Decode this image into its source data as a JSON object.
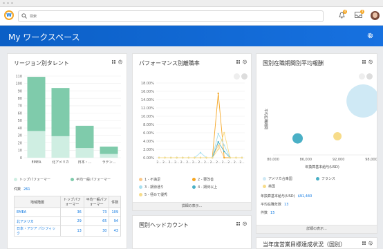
{
  "search": {
    "placeholder": "検索"
  },
  "header": {
    "notifications_count": "4",
    "inbox_count": "3"
  },
  "banner": {
    "title": "My ワークスペース"
  },
  "talent": {
    "title": "リージョン別タレント",
    "legend": [
      "トップパフォーマー",
      "平均一般パフォーマー"
    ],
    "count_label": "件数",
    "count_value": "261",
    "table_headers": [
      "地域階層",
      "トップパフォーマー",
      "平均一般パフォーマー",
      "件数"
    ],
    "table_rows": [
      {
        "region": "EMEA",
        "top": "36",
        "avg": "73",
        "count": "109"
      },
      {
        "region": "北アメリカ",
        "top": "29",
        "avg": "65",
        "count": "94"
      },
      {
        "region": "日本・アジア パシフィック",
        "top": "13",
        "avg": "30",
        "count": "43"
      }
    ]
  },
  "perf": {
    "title": "パフォーマンス別離職率",
    "legend": [
      "1 - 不満足",
      "2 - 要改善",
      "3 - 期待通り",
      "4 - 期待以上",
      "5 - 極めて優秀"
    ],
    "footer": "詳細の表示..."
  },
  "salary": {
    "title": "国別在職期間別平均報酬",
    "legend": [
      "アメリカ合衆国",
      "フランス",
      "英国"
    ],
    "kv": [
      {
        "label": "年換算基本給与(USD)",
        "value": "$91,440"
      },
      {
        "label": "平均在職年数",
        "value": "13"
      },
      {
        "label": "件数",
        "value": "15"
      }
    ],
    "footer": "詳細の表示..."
  },
  "headcount": {
    "title": "国別ヘッドカウント"
  },
  "sales": {
    "title": "当年度営業目標達成状況（国別）"
  },
  "colors": {
    "accent": "#0875e1",
    "top_performer": "#cfeee2",
    "avg_performer": "#7fcbab",
    "orange": "#f5a623",
    "teal": "#4ab0c6",
    "cyan": "#a9e0ef",
    "yellow": "#f7dc8a",
    "light_orange": "#fbc98a"
  },
  "chart_data": [
    {
      "type": "bar",
      "title": "リージョン別タレント",
      "categories": [
        "EMEA",
        "北アメリカ",
        "日本・...",
        "ラテン..."
      ],
      "series": [
        {
          "name": "トップパフォーマー",
          "values": [
            36,
            29,
            13,
            5
          ]
        },
        {
          "name": "平均一般パフォーマー",
          "values": [
            73,
            65,
            30,
            10
          ]
        }
      ],
      "ylim": [
        0,
        110
      ],
      "yticks": [
        "0",
        "10",
        "20",
        "30",
        "40",
        "50",
        "60",
        "70",
        "80",
        "90",
        "100",
        "110"
      ],
      "stacked": true,
      "grid": true,
      "legend": "bottom"
    },
    {
      "type": "line",
      "title": "パフォーマンス別離職率",
      "x": [
        "2...",
        "2...",
        "2...",
        "2...",
        "2...",
        "2...",
        "2...",
        "2...",
        "2...",
        "2...",
        "2...",
        "2...",
        "2...",
        "2...",
        "2..."
      ],
      "series": [
        {
          "name": "1 - 不満足",
          "values": [
            0,
            0,
            0,
            0,
            0,
            0,
            0,
            0,
            0,
            0,
            3.0,
            0,
            0,
            0,
            0
          ]
        },
        {
          "name": "2 - 要改善",
          "values": [
            0,
            0,
            0,
            0,
            0,
            0,
            0,
            0,
            0,
            0,
            15.5,
            0,
            0,
            0,
            0
          ]
        },
        {
          "name": "3 - 期待通り",
          "values": [
            0,
            0,
            0,
            0,
            0,
            0,
            0,
            1.2,
            0,
            0,
            5.8,
            3.0,
            0,
            0,
            0
          ]
        },
        {
          "name": "4 - 期待以上",
          "values": [
            0,
            0,
            0,
            0,
            0,
            0,
            0,
            0,
            0,
            0,
            3.8,
            1.5,
            0,
            0,
            0
          ]
        },
        {
          "name": "5 - 極めて優秀",
          "values": [
            0,
            0,
            0,
            0,
            0,
            0,
            0,
            0,
            0,
            0,
            2.0,
            6.0,
            0,
            0,
            0
          ]
        }
      ],
      "ylim": [
        0,
        18
      ],
      "yticks": [
        "0.00%",
        "2.00%",
        "4.00%",
        "6.00%",
        "8.00%",
        "10.00%",
        "12.00%",
        "14.00%",
        "16.00%",
        "18.00%"
      ],
      "grid": true,
      "legend": "bottom"
    },
    {
      "type": "scatter",
      "title": "国別在職期間別平均報酬",
      "xlabel": "年換算基本給与(USD)",
      "ylabel": "平均在職期間",
      "xticks": [
        "80,000",
        "86,000",
        "92,000",
        "98,000"
      ],
      "xlim": [
        80000,
        98000
      ],
      "series": [
        {
          "name": "アメリカ合衆国",
          "x": 96500,
          "y": 0.75,
          "size": 0.8
        },
        {
          "name": "フランス",
          "x": 84500,
          "y": 0.23,
          "size": 0.25
        },
        {
          "name": "英国",
          "x": 91800,
          "y": 0.26,
          "size": 0.2
        }
      ],
      "legend": "bottom"
    }
  ]
}
